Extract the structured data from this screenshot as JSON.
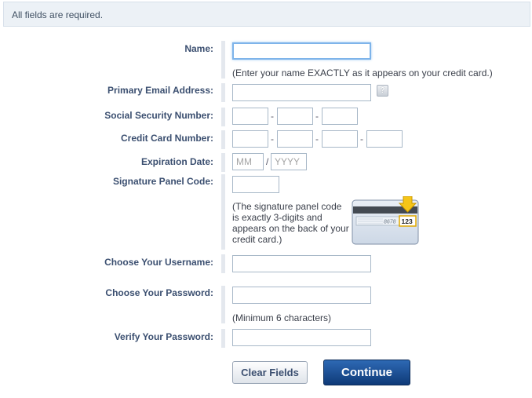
{
  "notice": {
    "text": "All fields are required."
  },
  "labels": {
    "name": "Name:",
    "email": "Primary Email Address:",
    "ssn": "Social Security Number:",
    "card": "Credit Card Number:",
    "expiration": "Expiration Date:",
    "signature": "Signature Panel Code:",
    "username": "Choose Your Username:",
    "password": "Choose Your Password:",
    "verify": "Verify Your Password:"
  },
  "hints": {
    "name": "(Enter your name EXACTLY as it appears on your credit card.)",
    "signature_lines": [
      "(The signature panel code",
      "is exactly 3-digits and",
      "appears on the back of your",
      "credit card.)"
    ],
    "password": "(Minimum 6 characters)"
  },
  "separators": {
    "dash": "-",
    "slash": "/"
  },
  "placeholders": {
    "month": "MM",
    "year": "YYYY"
  },
  "help": {
    "glyph": "?"
  },
  "card_image": {
    "signature_digits": "8678",
    "cvv": "123"
  },
  "buttons": {
    "clear": "Clear Fields",
    "continue": "Continue"
  },
  "colors": {
    "label": "#3b4f70",
    "continue_bg": "#1a4a8c",
    "notice_bg": "#ecf1f6",
    "focus": "#7eb4ea"
  }
}
